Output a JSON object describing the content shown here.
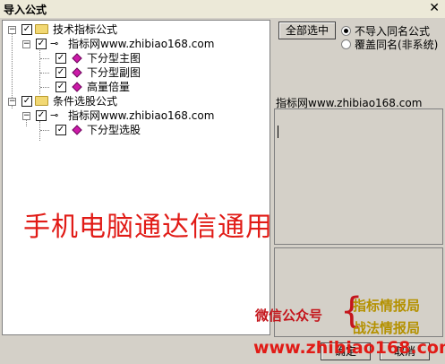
{
  "window": {
    "title": "导入公式",
    "close_glyph": "✕"
  },
  "tree": {
    "nodes": [
      {
        "label": "技术指标公式"
      },
      {
        "label": "指标网www.zhibiao168.com"
      },
      {
        "label": "下分型主图"
      },
      {
        "label": "下分型副图"
      },
      {
        "label": "高量倍量"
      },
      {
        "label": "条件选股公式"
      },
      {
        "label": "指标网www.zhibiao168.com"
      },
      {
        "label": "下分型选股"
      }
    ]
  },
  "toolbar": {
    "select_all": "全部选中"
  },
  "options": [
    {
      "label": "不导入同名公式",
      "selected": true
    },
    {
      "label": "覆盖同名(非系统)",
      "selected": false
    }
  ],
  "info": {
    "source": "指标网www.zhibiao168.com"
  },
  "footer": {
    "ok": "确定",
    "cancel": "取消"
  },
  "overlay": {
    "headline": "手机电脑通达信通用",
    "wechat": "微信公众号",
    "brace": "{",
    "brand_top": "指标情报局",
    "brand_bottom": "战法情报局",
    "url": "www.zhibiao168.com"
  },
  "colors": {
    "overlay_red": "#e11b16",
    "brand_gold": "#b49100",
    "gem": "#cc1aa8"
  }
}
